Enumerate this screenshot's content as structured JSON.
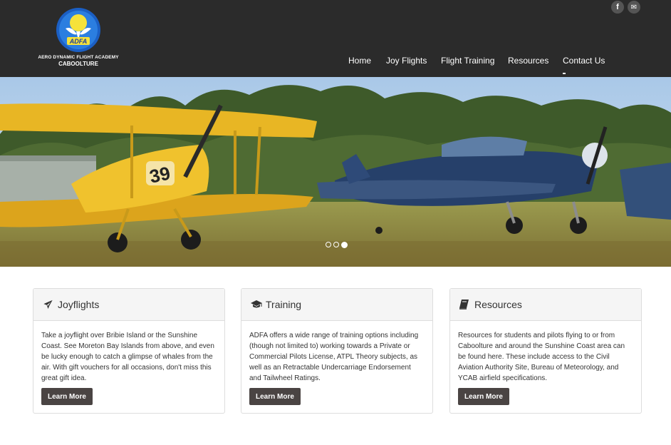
{
  "brand": {
    "logo_text": "ADFA",
    "name": "AERO DYNAMIC FLIGHT ACADEMY",
    "location": "CABOOLTURE"
  },
  "social": [
    {
      "icon": "facebook-icon",
      "glyph": "f"
    },
    {
      "icon": "envelope-icon",
      "glyph": "✉"
    }
  ],
  "nav": {
    "items": [
      {
        "label": "Home"
      },
      {
        "label": "Joy Flights"
      },
      {
        "label": "Flight Training"
      },
      {
        "label": "Resources"
      },
      {
        "label": "Contact Us"
      }
    ]
  },
  "carousel": {
    "slides": 3,
    "active_index": 2,
    "slide_description": "Yellow biplane numbered 39 and a blue vintage warbird on a grass airfield",
    "aircraft_number": "39"
  },
  "panels": [
    {
      "icon": "plane-icon",
      "title": "Joyflights",
      "text": "Take a joyflight over Bribie Island or the Sunshine Coast. See Moreton Bay Islands from above, and even be lucky enough to catch a glimpse of whales from the air. With gift vouchers for all occasions, don't miss this great gift idea.",
      "button": "Learn More"
    },
    {
      "icon": "graduation-cap-icon",
      "title": "Training",
      "text": "ADFA offers a wide range of training options including (though not limited to) working towards a Private or Commercial Pilots License, ATPL Theory subjects, as well as an Retractable Undercarriage Endorsement and Tailwheel Ratings.",
      "button": "Learn More"
    },
    {
      "icon": "book-icon",
      "title": "Resources",
      "text": "Resources for students and pilots flying to or from Caboolture and around the Sunshine Coast area can be found here. These include access to the Civil Aviation Authority Site, Bureau of Meteorology, and YCAB airfield specifications.",
      "button": "Learn More"
    }
  ],
  "colors": {
    "header_bg": "#2b2b2b",
    "button_bg": "#4a4443",
    "panel_head_bg": "#f5f5f5"
  }
}
